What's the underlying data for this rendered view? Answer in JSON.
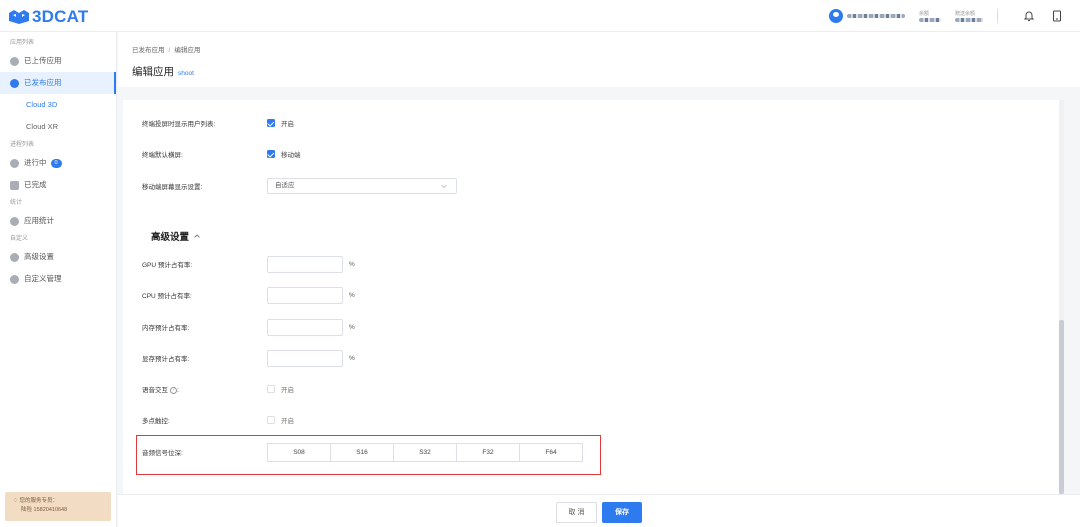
{
  "brand": {
    "name": "3DCAT",
    "color": "#2e7bf0"
  },
  "topbar": {
    "balance_label": "余额",
    "gift_balance_label": "赠送余额",
    "icons": [
      "user-avatar",
      "bell-icon",
      "tablet-icon"
    ]
  },
  "sidebar": {
    "groups": {
      "apps": "应用列表",
      "process": "进程列表",
      "stats": "统计",
      "custom": "自定义"
    },
    "items": {
      "uploaded": "已上传应用",
      "published": "已发布应用",
      "cloud3d": "Cloud 3D",
      "cloudxr": "Cloud XR",
      "running": "进行中",
      "running_count": "0",
      "done": "已完成",
      "app_stats": "应用统计",
      "advanced": "高级设置",
      "custom_mgmt": "自定义管理"
    },
    "service": {
      "title": "您的服务专员：",
      "contact": "陆险  15820410648"
    }
  },
  "header": {
    "breadcrumb": [
      "已发布应用",
      "编辑应用"
    ],
    "title": "编辑应用",
    "subtitle": "shoot"
  },
  "form": {
    "show_user_list": {
      "label": "终端投屏时显示用户列表:",
      "option": "开启",
      "checked": true
    },
    "landscape": {
      "label": "终端默认横屏:",
      "option": "移动端",
      "checked": true
    },
    "mobile_display": {
      "label": "移动端屏幕显示设置:",
      "value": "自适应"
    },
    "advanced_title": "高级设置",
    "gpu": {
      "label": "GPU 预计占有率:",
      "unit": "%"
    },
    "cpu": {
      "label": "CPU 预计占有率:",
      "unit": "%"
    },
    "memory": {
      "label": "内存预计占有率:",
      "unit": "%"
    },
    "vram": {
      "label": "显存预计占有率:",
      "unit": "%"
    },
    "voice": {
      "label": "语音交互",
      "help": "?",
      "option": "开启",
      "checked": false
    },
    "multitouch": {
      "label": "多点触控:",
      "option": "开启",
      "checked": false
    },
    "audio_depth": {
      "label": "音频信号位深:",
      "options": [
        "S08",
        "S16",
        "S32",
        "F32",
        "F64"
      ]
    }
  },
  "footer": {
    "cancel": "取 消",
    "save": "保存"
  }
}
